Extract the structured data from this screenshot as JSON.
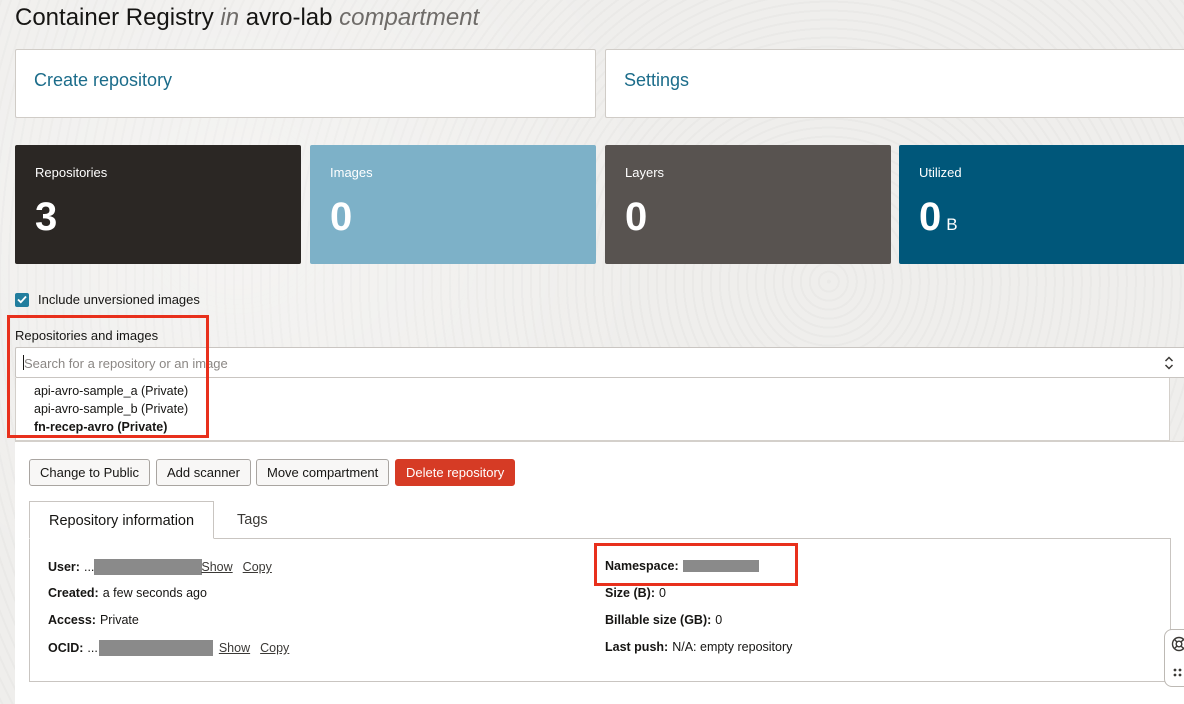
{
  "header": {
    "title_main": "Container Registry",
    "title_in": "in",
    "title_compartment": "avro-lab",
    "title_suffix": "compartment"
  },
  "actions": {
    "create_repository": "Create repository",
    "settings": "Settings"
  },
  "stats": [
    {
      "label": "Repositories",
      "value": "3",
      "unit": "",
      "color": "#2b2724"
    },
    {
      "label": "Images",
      "value": "0",
      "unit": "",
      "color": "#7db1c8"
    },
    {
      "label": "Layers",
      "value": "0",
      "unit": "",
      "color": "#585350"
    },
    {
      "label": "Utilized",
      "value": "0",
      "unit": "B",
      "color": "#00577a"
    }
  ],
  "filters": {
    "include_unversioned_label": "Include unversioned images",
    "include_unversioned_checked": true
  },
  "repo_section": {
    "label": "Repositories and images",
    "search_placeholder": "Search for a repository or an image",
    "items": [
      {
        "label": "api-avro-sample_a (Private)",
        "selected": false
      },
      {
        "label": "api-avro-sample_b (Private)",
        "selected": false
      },
      {
        "label": "fn-recep-avro (Private)",
        "selected": true
      }
    ]
  },
  "repo_actions": {
    "change_to_public": "Change to Public",
    "add_scanner": "Add scanner",
    "move_compartment": "Move compartment",
    "delete_repository": "Delete repository"
  },
  "tabs": [
    {
      "label": "Repository information",
      "active": true
    },
    {
      "label": "Tags",
      "active": false
    }
  ],
  "repo_info": {
    "user_label": "User:",
    "user_value_prefix": "...",
    "show_label": "Show",
    "copy_label": "Copy",
    "created_label": "Created:",
    "created_value": "a few seconds ago",
    "access_label": "Access:",
    "access_value": "Private",
    "ocid_label": "OCID:",
    "ocid_value_prefix": "...",
    "namespace_label": "Namespace:",
    "size_label": "Size (B):",
    "size_value": "0",
    "billable_label": "Billable size (GB):",
    "billable_value": "0",
    "last_push_label": "Last push:",
    "last_push_value": "N/A: empty repository"
  },
  "colors": {
    "accent_link": "#1b6c8a",
    "danger": "#d63b25",
    "highlight": "#e8301c"
  }
}
